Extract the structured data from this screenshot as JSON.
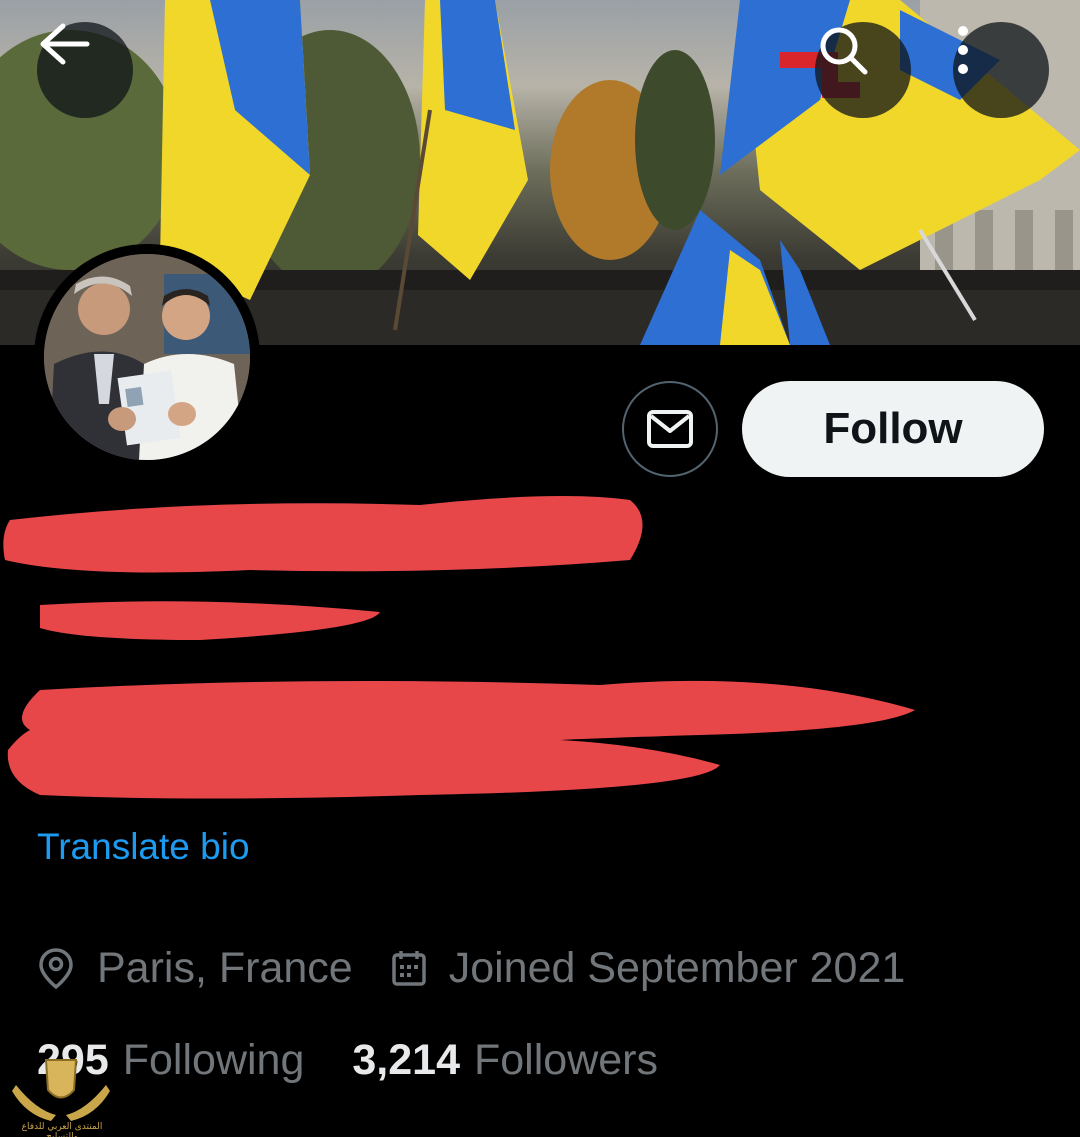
{
  "header": {
    "back_icon": "arrow-left-icon",
    "search_icon": "search-icon",
    "more_icon": "more-vertical-icon"
  },
  "profile": {
    "avatar_icon": "avatar",
    "dm_icon": "mail-icon",
    "follow_label": "Follow",
    "translate_label": "Translate bio",
    "location": "Paris, France",
    "joined": "Joined September 2021",
    "following_count": "295",
    "following_label": "Following",
    "followers_count": "3,214",
    "followers_label": "Followers"
  },
  "colors": {
    "background": "#000000",
    "follow_button_bg": "#eff3f4",
    "link": "#1d9bf0",
    "secondary_text": "#71767b",
    "redaction": "#e8474a"
  },
  "watermark": {
    "text": "المنتدى العربي للدفاع والتسليح"
  }
}
